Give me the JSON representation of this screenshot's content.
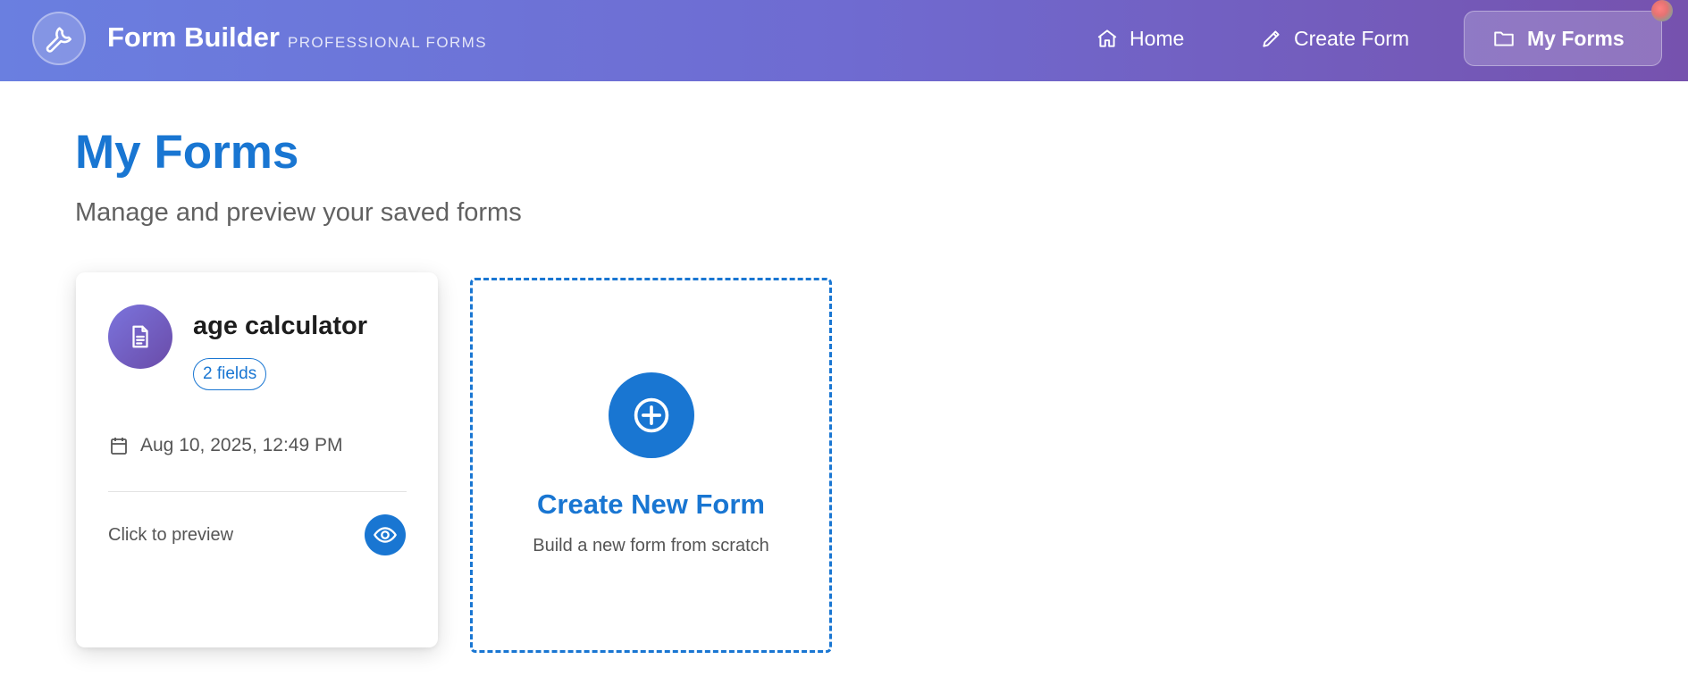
{
  "colors": {
    "accent": "#1976d2",
    "header_gradient_start": "#6a7fe0",
    "header_gradient_end": "#7652ae",
    "avatar_gradient_start": "#7b74dd",
    "avatar_gradient_end": "#6a4ba8"
  },
  "header": {
    "logo_icon": "wrench-icon",
    "title": "Form Builder",
    "subtitle": "PROFESSIONAL FORMS",
    "nav": [
      {
        "label": "Home",
        "icon": "home-icon",
        "active": false
      },
      {
        "label": "Create Form",
        "icon": "pencil-icon",
        "active": false
      },
      {
        "label": "My Forms",
        "icon": "folder-icon",
        "active": true
      }
    ]
  },
  "page": {
    "title": "My Forms",
    "subtitle": "Manage and preview your saved forms"
  },
  "forms": [
    {
      "icon": "document-icon",
      "name": "age calculator",
      "fields_badge": "2 fields",
      "date_icon": "calendar-icon",
      "date": "Aug 10, 2025, 12:49 PM",
      "preview_label": "Click to preview",
      "preview_icon": "eye-icon"
    }
  ],
  "create_card": {
    "icon": "plus-circle-icon",
    "title": "Create New Form",
    "subtitle": "Build a new form from scratch"
  }
}
